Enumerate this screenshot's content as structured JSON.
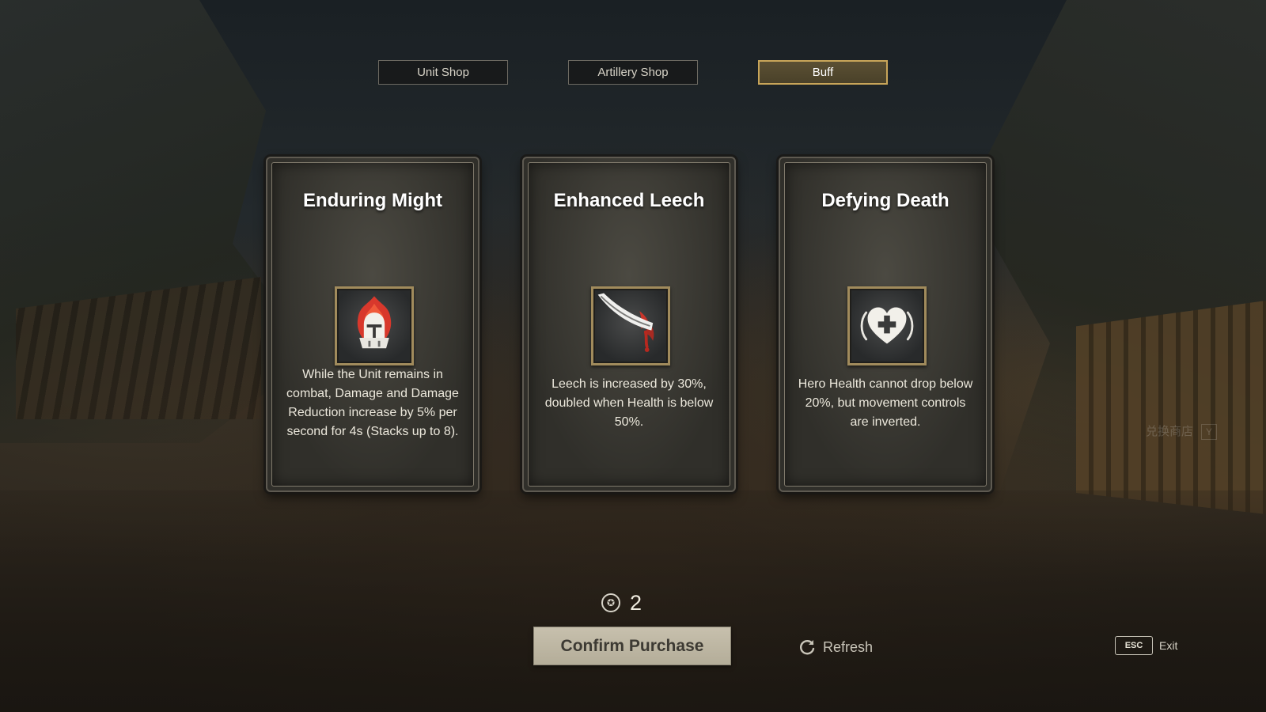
{
  "tabs": [
    {
      "label": "Unit Shop",
      "active": false
    },
    {
      "label": "Artillery Shop",
      "active": false
    },
    {
      "label": "Buff",
      "active": true
    }
  ],
  "cards": [
    {
      "title": "Enduring Might",
      "icon": "flaming-knight-helmet-icon",
      "description": "While the Unit remains in combat, Damage and Damage Reduction increase by 5% per second for 4s (Stacks up to 8)."
    },
    {
      "title": "Enhanced Leech",
      "icon": "bloody-blade-icon",
      "description": "Leech is increased by 30%, doubled when Health is below 50%."
    },
    {
      "title": "Defying Death",
      "icon": "heart-plus-icon",
      "description": "Hero Health cannot drop below 20%, but movement controls are inverted."
    }
  ],
  "currency": {
    "icon": "token-coin-icon",
    "value": "2"
  },
  "confirm_button": "Confirm Purchase",
  "refresh_label": "Refresh",
  "exit": {
    "key": "ESC",
    "label": "Exit"
  },
  "background_hint": {
    "text": "兑换商店",
    "key": "Y"
  },
  "colors": {
    "active_tab_border": "#c8a559",
    "card_border": "#5e5a51",
    "icon_frame": "#a18b5c",
    "confirm_button_bg": "#c7c0ad"
  }
}
